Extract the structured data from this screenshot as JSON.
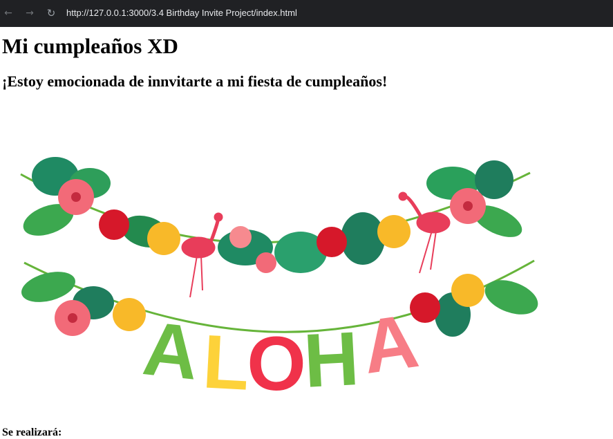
{
  "browser": {
    "url": "http://127.0.0.1:3000/3.4 Birthday Invite Project/index.html"
  },
  "page": {
    "title": "Mi cumpleaños XD",
    "subtitle": "¡Estoy emocionada de innvitarte a mi fiesta de cumpleaños!",
    "section_label": "Se realizará:"
  },
  "banner": {
    "letters": [
      "A",
      "L",
      "O",
      "H",
      "A"
    ],
    "letter_colors": [
      "#6dbd45",
      "#fdd23a",
      "#f0324a",
      "#6dbd45",
      "#f77d86"
    ]
  }
}
